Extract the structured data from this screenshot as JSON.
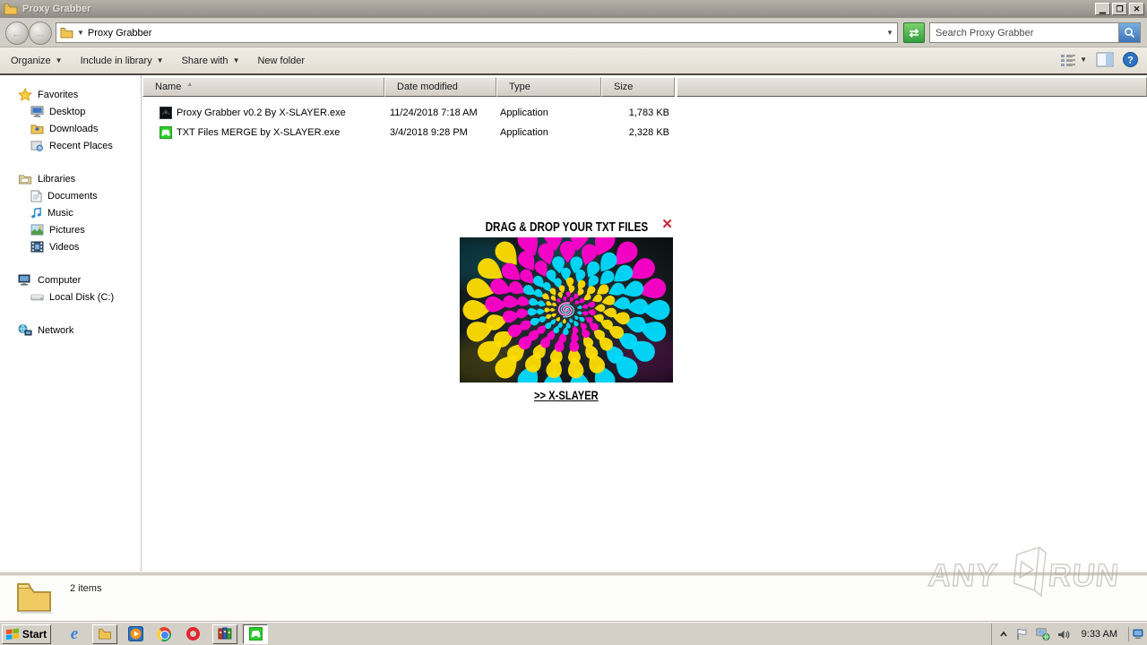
{
  "titlebar": {
    "title": "Proxy Grabber"
  },
  "nav": {
    "address": "Proxy Grabber",
    "search_placeholder": "Search Proxy Grabber"
  },
  "toolbar": {
    "organize": "Organize",
    "include_in_library": "Include in library",
    "share_with": "Share with",
    "new_folder": "New folder"
  },
  "columns": {
    "name": "Name",
    "date": "Date modified",
    "type": "Type",
    "size": "Size"
  },
  "files": [
    {
      "name": "Proxy Grabber v0.2 By X-SLAYER.exe",
      "date": "11/24/2018 7:18 AM",
      "type": "Application",
      "size": "1,783 KB"
    },
    {
      "name": "TXT Files MERGE by X-SLAYER.exe",
      "date": "3/4/2018 9:28 PM",
      "type": "Application",
      "size": "2,328 KB"
    }
  ],
  "sidebar": {
    "favorites": {
      "label": "Favorites",
      "items": [
        {
          "label": "Desktop"
        },
        {
          "label": "Downloads"
        },
        {
          "label": "Recent Places"
        }
      ]
    },
    "libraries": {
      "label": "Libraries",
      "items": [
        {
          "label": "Documents"
        },
        {
          "label": "Music"
        },
        {
          "label": "Pictures"
        },
        {
          "label": "Videos"
        }
      ]
    },
    "computer": {
      "label": "Computer",
      "items": [
        {
          "label": "Local Disk (C:)"
        }
      ]
    },
    "network": {
      "label": "Network"
    }
  },
  "overlay": {
    "title": "DRAG & DROP YOUR TXT FILES",
    "close_glyph": "✕",
    "link": ">> X-SLAYER",
    "spiral": {
      "colors": [
        "#00dcff",
        "#ffdd00",
        "#ff00cc"
      ],
      "bg_center": "#2b3438",
      "bg_edge": "#0a0e10",
      "center_spiral": [
        "#ff85e0",
        "#7fe8ff"
      ]
    }
  },
  "status": {
    "count": "2 items"
  },
  "taskbar": {
    "start_label": "Start",
    "clock": "9:33 AM"
  },
  "watermark": {
    "left": "ANY",
    "right": "RUN"
  }
}
